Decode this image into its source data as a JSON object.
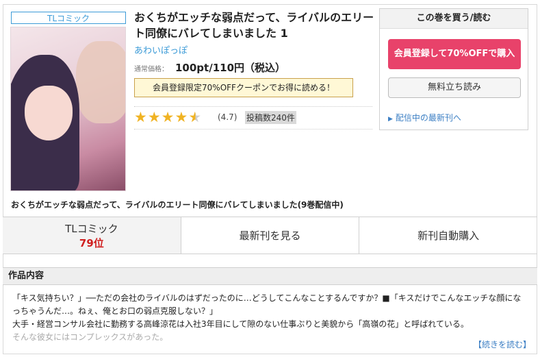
{
  "product": {
    "badge": "TLコミック",
    "title": "おくちがエッチな弱点だって、ライバルのエリート同僚にバレてしまいました 1",
    "author": "あわいぽっぽ",
    "price_label": "通常価格：",
    "price": "100pt/110円（税込）",
    "coupon": "会員登録限定70%OFFクーポンでお得に読める！",
    "rating_value": "(4.7)",
    "rating_score": 4.7,
    "review_count": "投稿数240件"
  },
  "buybox": {
    "header": "この巻を買う/読む",
    "register_button": "会員登録して70%OFFで購入",
    "preview_button": "無料立ち読み",
    "latest_link": "配信中の最新刊へ"
  },
  "series_line": "おくちがエッチな弱点だって、ライバルのエリート同僚にバレてしまいました(9巻配信中)",
  "tabs": {
    "genre": "TLコミック",
    "rank": "79位",
    "latest": "最新刊を見る",
    "auto_buy": "新刊自動購入"
  },
  "content": {
    "heading": "作品内容",
    "lines": [
      "「キス気持ちい？」──ただの会社のライバルのはずだったのに…どうしてこんなことするんですか？■「キスだけでこんなエッチな顔になっちゃうんだ…。ねぇ、俺とお口の弱点克服しない？」",
      "大手・経営コンサル会社に勤務する高峰涼花は入社3年目にして隙のない仕事ぶりと美貌から「高嶺の花」と呼ばれている。",
      "そんな彼女にはコンプレックスがあった。"
    ],
    "more": "【続きを読む】"
  },
  "colors": {
    "accent_blue": "#3c9bd7",
    "register_pink": "#e8426a",
    "rank_red": "#d02020",
    "star_gold": "#f0b323"
  }
}
